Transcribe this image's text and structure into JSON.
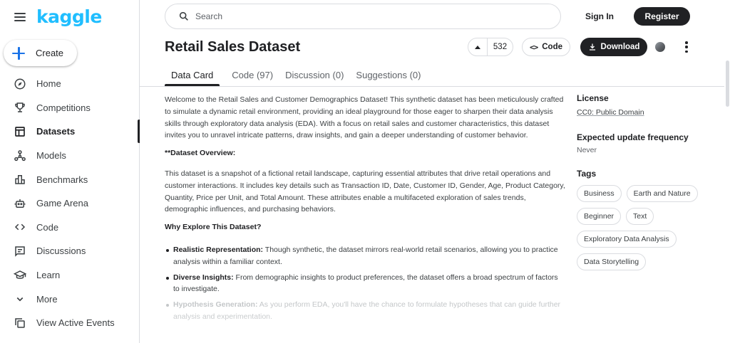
{
  "brand": {
    "name": "kaggle",
    "color": "#20beff"
  },
  "sidebar": {
    "create_label": "Create",
    "items": [
      {
        "label": "Home",
        "icon": "compass-icon"
      },
      {
        "label": "Competitions",
        "icon": "trophy-icon"
      },
      {
        "label": "Datasets",
        "icon": "table-icon",
        "active": true
      },
      {
        "label": "Models",
        "icon": "models-icon"
      },
      {
        "label": "Benchmarks",
        "icon": "bar-chart-icon"
      },
      {
        "label": "Game Arena",
        "icon": "robot-icon"
      },
      {
        "label": "Code",
        "icon": "code-icon"
      },
      {
        "label": "Discussions",
        "icon": "discussion-icon"
      },
      {
        "label": "Learn",
        "icon": "school-icon"
      },
      {
        "label": "More",
        "icon": "chevron-down-icon"
      },
      {
        "label": "View Active Events",
        "icon": "events-icon"
      }
    ]
  },
  "header": {
    "search_placeholder": "Search",
    "signin_label": "Sign In",
    "register_label": "Register"
  },
  "dataset": {
    "title": "Retail Sales Dataset",
    "upvotes": "532",
    "code_label": "Code",
    "download_label": "Download"
  },
  "tabs": [
    {
      "label": "Data Card",
      "active": true
    },
    {
      "label": "Code (97)"
    },
    {
      "label": "Discussion (0)"
    },
    {
      "label": "Suggestions (0)"
    }
  ],
  "content": {
    "intro": "Welcome to the Retail Sales and Customer Demographics Dataset! This synthetic dataset has been meticulously crafted to simulate a dynamic retail environment, providing an ideal playground for those eager to sharpen their data analysis skills through exploratory data analysis (EDA). With a focus on retail sales and customer characteristics, this dataset invites you to unravel intricate patterns, draw insights, and gain a deeper understanding of customer behavior.",
    "overview_heading": "**Dataset Overview:",
    "overview_text": "This dataset is a snapshot of a fictional retail landscape, capturing essential attributes that drive retail operations and customer interactions. It includes key details such as Transaction ID, Date, Customer ID, Gender, Age, Product Category, Quantity, Price per Unit, and Total Amount. These attributes enable a multifaceted exploration of sales trends, demographic influences, and purchasing behaviors.",
    "why_heading": "Why Explore This Dataset?",
    "bullets": [
      {
        "title": "Realistic Representation:",
        "text": " Though synthetic, the dataset mirrors real-world retail scenarios, allowing you to practice analysis within a familiar context."
      },
      {
        "title": "Diverse Insights:",
        "text": " From demographic insights to product preferences, the dataset offers a broad spectrum of factors to investigate."
      },
      {
        "title": "Hypothesis Generation:",
        "text": " As you perform EDA, you'll have the chance to formulate hypotheses that can guide further analysis and experimentation."
      }
    ]
  },
  "panel": {
    "license_heading": "License",
    "license_value": "CC0: Public Domain",
    "frequency_heading": "Expected update frequency",
    "frequency_value": "Never",
    "tags_heading": "Tags",
    "tags": [
      "Business",
      "Earth and Nature",
      "Beginner",
      "Text",
      "Exploratory Data Analysis",
      "Data Storytelling"
    ]
  }
}
